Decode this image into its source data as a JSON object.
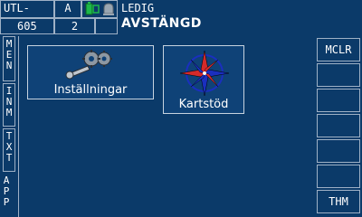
{
  "header": {
    "unit_label": "UTL-",
    "mode": "A",
    "unit_number": "605",
    "channel": "2",
    "status_line1": "LEDIG",
    "status_line2": "AVSTÄNGD",
    "icons": [
      "battery-icon",
      "bell-icon"
    ]
  },
  "tabs": [
    {
      "id": "men",
      "label": [
        "M",
        "E",
        "N"
      ]
    },
    {
      "id": "inm",
      "label": [
        "I",
        "N",
        "M"
      ]
    },
    {
      "id": "txt",
      "label": [
        "T",
        "X",
        "T"
      ]
    },
    {
      "id": "app",
      "label": [
        "A",
        "P",
        "P"
      ]
    }
  ],
  "apps": [
    {
      "label": "Inställningar",
      "icon": "wrench-gears-icon"
    },
    {
      "label": "Kartstöd",
      "icon": "compass-rose-icon"
    }
  ],
  "softkeys": [
    "MCLR",
    "",
    "",
    "",
    "",
    "",
    "THM"
  ],
  "colors": {
    "background": "#0b3a69",
    "border": "#9fb1c6",
    "compass_red": "#d42a2a",
    "compass_blue": "#1a2fbf"
  }
}
